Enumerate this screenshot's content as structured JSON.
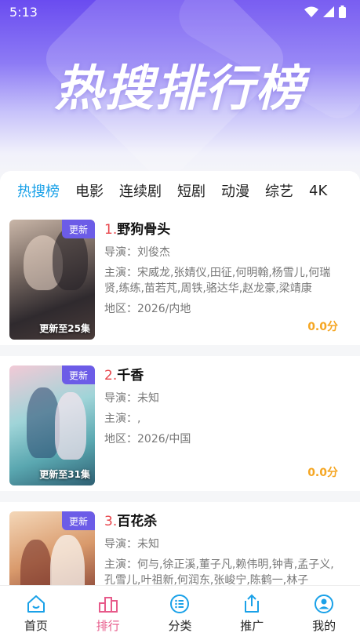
{
  "status": {
    "time": "5:13"
  },
  "header": {
    "title": "热搜排行榜"
  },
  "tabs": [
    {
      "label": "热搜榜"
    },
    {
      "label": "电影"
    },
    {
      "label": "连续剧"
    },
    {
      "label": "短剧"
    },
    {
      "label": "动漫"
    },
    {
      "label": "综艺"
    },
    {
      "label": "4K"
    }
  ],
  "items": [
    {
      "rank": "1.",
      "title": "野狗骨头",
      "badge": "更新",
      "episodes": "更新至25集",
      "director": "导演：刘俊杰",
      "cast": "主演：宋威龙,张婧仪,田征,何明翰,杨雪儿,何瑞贤,练练,苗若芃,周铁,骆达华,赵龙豪,梁靖康",
      "region": "地区：2026/内地",
      "score": "0.0分"
    },
    {
      "rank": "2.",
      "title": "千香",
      "badge": "更新",
      "episodes": "更新至31集",
      "director": "导演：未知",
      "cast": "主演：,",
      "region": "地区：2026/中国",
      "score": "0.0分"
    },
    {
      "rank": "3.",
      "title": "百花杀",
      "badge": "更新",
      "episodes": "",
      "director": "导演：未知",
      "cast": "主演：何与,徐正溪,董子凡,赖伟明,钟青,孟子义,孔雪儿,叶祖新,何润东,张峻宁,陈鹤一,林子",
      "region": "",
      "score": ""
    }
  ],
  "bottom_nav": [
    {
      "label": "首页",
      "icon": "home-icon"
    },
    {
      "label": "排行",
      "icon": "ranking-icon"
    },
    {
      "label": "分类",
      "icon": "category-icon"
    },
    {
      "label": "推广",
      "icon": "share-icon"
    },
    {
      "label": "我的",
      "icon": "profile-icon"
    }
  ],
  "colors": {
    "accent": "#1aa1e8",
    "rank_red": "#e8454b",
    "score_orange": "#f5a623",
    "badge_purple": "#6c5ce7",
    "nav_active": "#e75a8a"
  }
}
